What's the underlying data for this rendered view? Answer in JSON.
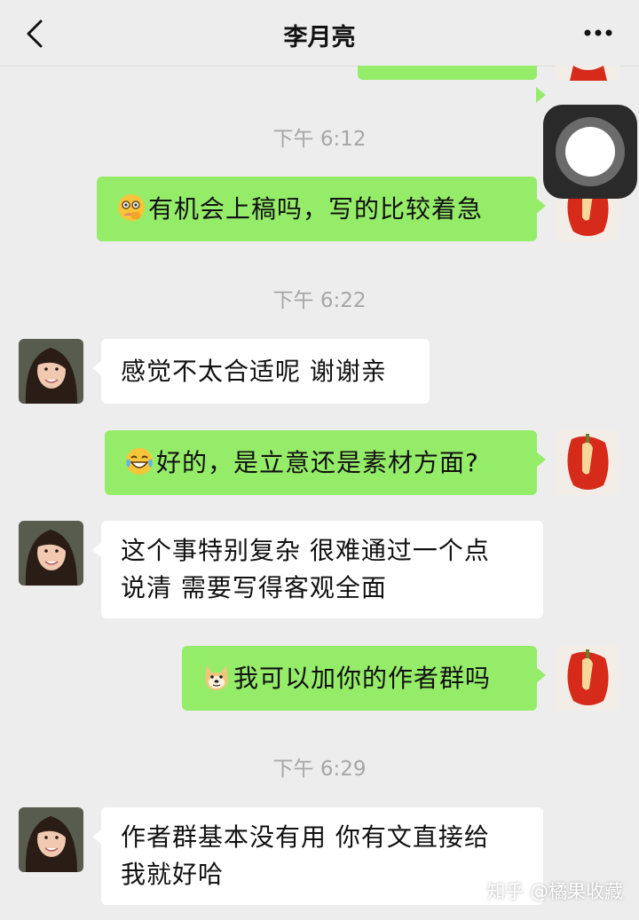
{
  "header": {
    "title": "李月亮"
  },
  "timestamps": [
    "下午 6:12",
    "下午 6:22",
    "下午 6:29"
  ],
  "messages": [
    {
      "from": "me",
      "emoji": "thinking-face-emoji",
      "text": "有机会上稿吗，写的比较着急"
    },
    {
      "from": "contact",
      "text": "感觉不太合适呢 谢谢亲"
    },
    {
      "from": "me",
      "emoji": "laughing-tears-emoji",
      "text": "好的，是立意还是素材方面?"
    },
    {
      "from": "contact",
      "lines": [
        "这个事特别复杂 很难通过一个点",
        "说清 需要写得客观全面"
      ]
    },
    {
      "from": "me",
      "emoji": "doge-emoji",
      "text": "我可以加你的作者群吗"
    },
    {
      "from": "contact",
      "lines": [
        "作者群基本没有用 你有文直接给",
        "我就好哈"
      ]
    }
  ],
  "watermark": "知乎 @橘果收藏",
  "colors": {
    "background": "#ededed",
    "my_bubble": "#95ec69",
    "their_bubble": "#ffffff",
    "timestamp": "#a6a6a6"
  }
}
